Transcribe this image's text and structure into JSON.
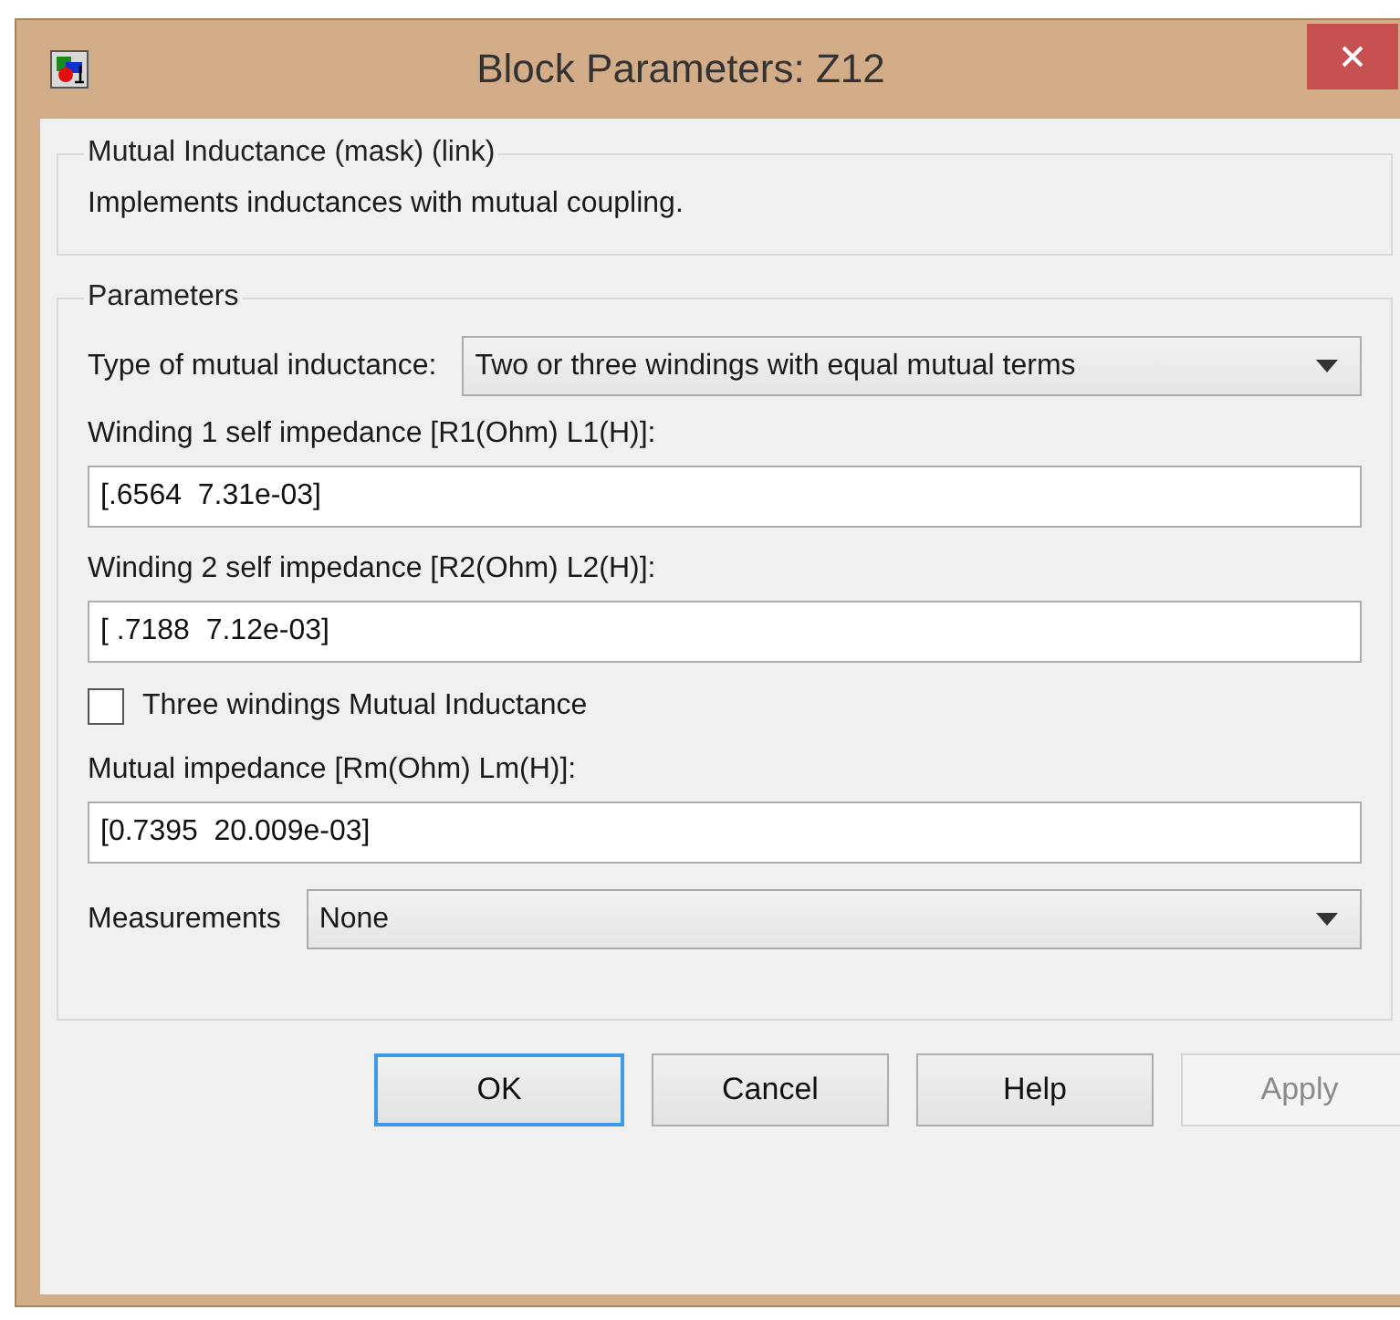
{
  "window": {
    "title": "Block Parameters: Z12"
  },
  "mask": {
    "legend": "Mutual Inductance (mask) (link)",
    "description": "Implements inductances with mutual coupling."
  },
  "parameters": {
    "legend": "Parameters",
    "items": [
      {
        "kind": "dropdown",
        "label": "Type of mutual inductance:",
        "value": "Two or three windings with equal mutual terms"
      },
      {
        "kind": "text",
        "label": "Winding 1 self impedance [R1(Ohm) L1(H)]:",
        "value": "[.6564  7.31e-03]"
      },
      {
        "kind": "text",
        "label": "Winding 2 self impedance [R2(Ohm) L2(H)]:",
        "value": "[ .7188  7.12e-03]"
      },
      {
        "kind": "checkbox",
        "label": "Three windings Mutual Inductance",
        "checked": false
      },
      {
        "kind": "text",
        "label": "Mutual impedance [Rm(Ohm) Lm(H)]:",
        "value": "[0.7395  20.009e-03]"
      },
      {
        "kind": "dropdown",
        "label": "Measurements",
        "value": "None"
      }
    ]
  },
  "buttons": [
    {
      "label": "OK",
      "default": true,
      "disabled": false
    },
    {
      "label": "Cancel",
      "default": false,
      "disabled": false
    },
    {
      "label": "Help",
      "default": false,
      "disabled": false
    },
    {
      "label": "Apply",
      "default": false,
      "disabled": true
    }
  ]
}
